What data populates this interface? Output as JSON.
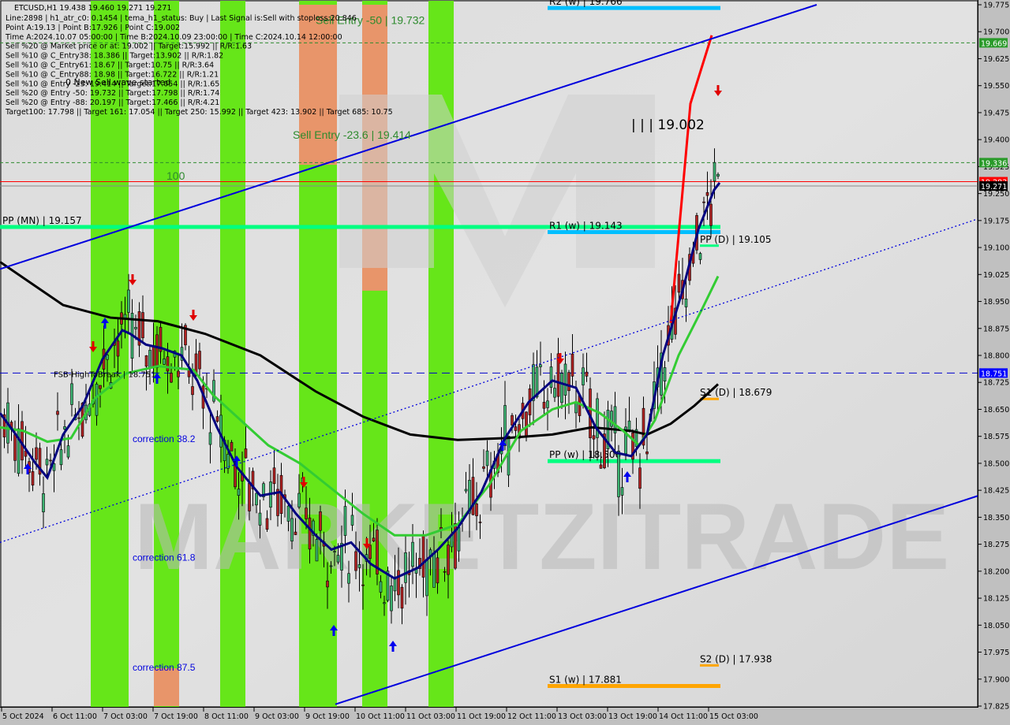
{
  "header": {
    "symbol_line": "ETCUSD,H1  19.438 19.460 19.271 19.271",
    "info_lines": [
      "Line:2898 | h1_atr_c0: 0.1454 | tema_h1_status: Buy | Last Signal is:Sell with stoploss:20.846",
      "Point A:19.13 | Point B:17.926 | Point C:19.002",
      "Time A:2024.10.07 05:00:00 | Time B:2024.10.09 23:00:00 | Time C:2024.10.14 12:00:00",
      "Sell %20 @ Market price or at: 19.002 || Target:15.992 || R/R:1.63",
      "Sell %10 @ C_Entry38: 18.386 || Target:13.902 || R/R:1.82",
      "Sell %10 @ C_Entry61: 18.67 || Target:10.75 || R/R:3.64",
      "Sell %10 @ C_Entry88: 18.98 || Target:16.722 || R/R:1.21",
      "Sell %10 @ Entry -23: 19.414 || Target:17.054 || R/R:1.65",
      "Sell %20 @ Entry -50: 19.732 || Target:17.798 || R/R:1.74",
      "Sell %20 @ Entry -88: 20.197 || Target:17.466 || R/R:4.21",
      "Target100: 17.798 || Target 161: 17.054 || Target 250: 15.992 || Target 423: 13.902 || Target 685: 10.75"
    ],
    "overlay_note": "0 New Sell wave started"
  },
  "watermark": "MARKETZITRADE",
  "chart_data": {
    "type": "candlestick",
    "title": "ETCUSD,H1",
    "xlabel": "",
    "ylabel": "",
    "ylim": [
      17.825,
      19.775
    ],
    "grid": false,
    "x_tick_labels": [
      "5 Oct 2024",
      "6 Oct 11:00",
      "7 Oct 03:00",
      "7 Oct 19:00",
      "8 Oct 11:00",
      "9 Oct 03:00",
      "9 Oct 19:00",
      "10 Oct 11:00",
      "11 Oct 03:00",
      "11 Oct 19:00",
      "12 Oct 11:00",
      "13 Oct 03:00",
      "13 Oct 19:00",
      "14 Oct 11:00",
      "15 Oct 03:00"
    ],
    "y_tick_labels": [
      "19.775",
      "19.700",
      "19.625",
      "19.550",
      "19.475",
      "19.400",
      "19.325",
      "19.250",
      "19.175",
      "19.100",
      "19.025",
      "18.950",
      "18.875",
      "18.800",
      "18.725",
      "18.650",
      "18.575",
      "18.500",
      "18.425",
      "18.350",
      "18.275",
      "18.200",
      "18.125",
      "18.050",
      "17.975",
      "17.900",
      "17.825"
    ],
    "y_ticks": [
      19.775,
      19.7,
      19.625,
      19.55,
      19.475,
      19.4,
      19.325,
      19.25,
      19.175,
      19.1,
      19.025,
      18.95,
      18.875,
      18.8,
      18.725,
      18.65,
      18.575,
      18.5,
      18.425,
      18.35,
      18.275,
      18.2,
      18.125,
      18.05,
      17.975,
      17.9,
      17.825
    ],
    "price_badges": [
      {
        "label": "19.669",
        "value": 19.669,
        "color": "#2a9a2a",
        "text": "#ffffff"
      },
      {
        "label": "19.336",
        "value": 19.336,
        "color": "#2a9a2a",
        "text": "#ffffff"
      },
      {
        "label": "19.283",
        "value": 19.283,
        "color": "#ff0000",
        "text": "#ffffff"
      },
      {
        "label": "19.271",
        "value": 19.271,
        "color": "#000000",
        "text": "#ffffff"
      },
      {
        "label": "18.751",
        "value": 18.751,
        "color": "#0000ff",
        "text": "#ffffff"
      }
    ],
    "levels": [
      {
        "name": "PP (MN)",
        "label": "PP (MN) | 19.157",
        "value": 19.157,
        "color": "#00ff80",
        "span": "full"
      },
      {
        "name": "R1 (w)",
        "label": "R1 (w) | 19.143",
        "value": 19.143,
        "color": "#00bfff",
        "span": "weekly"
      },
      {
        "name": "R2 (w)",
        "label": "R2 (w) | 19.766",
        "value": 19.766,
        "color": "#00bfff",
        "span": "weekly"
      },
      {
        "name": "PP (w)",
        "label": "PP (w) | 18.506",
        "value": 18.506,
        "color": "#00ff80",
        "span": "weekly"
      },
      {
        "name": "S1 (w)",
        "label": "S1 (w) | 17.881",
        "value": 17.881,
        "color": "#ffa500",
        "span": "weekly"
      },
      {
        "name": "PP (D)",
        "label": "PP (D) | 19.105",
        "value": 19.105,
        "color": "#00ff80",
        "span": "daily"
      },
      {
        "name": "S1 (D)",
        "label": "S1 (D) | 18.679",
        "value": 18.679,
        "color": "#ffa500",
        "span": "daily"
      },
      {
        "name": "S2 (D)",
        "label": "S2 (D) | 17.938",
        "value": 17.938,
        "color": "#ffa500",
        "span": "daily"
      }
    ],
    "annotations": [
      {
        "text": "Sell Entry -50 | 19.732",
        "value": 19.732,
        "kind": "sell-entry"
      },
      {
        "text": "Sell Entry -23.6 | 19.414",
        "value": 19.414,
        "kind": "sell-entry"
      },
      {
        "text": "100",
        "value": 19.3,
        "kind": "fib"
      },
      {
        "text": "FSB-HighToBreak | 18.751",
        "value": 18.751,
        "kind": "breakout"
      },
      {
        "text": "| | | 19.002",
        "value": 19.44,
        "kind": "point-c"
      },
      {
        "text": "correction 38.2",
        "value": 18.57,
        "kind": "correction"
      },
      {
        "text": "correction 61.8",
        "value": 18.24,
        "kind": "correction"
      },
      {
        "text": "correction 87.5",
        "value": 17.935,
        "kind": "correction"
      }
    ],
    "dashed_levels": [
      19.669,
      19.336
    ],
    "close_line": 19.271,
    "bid_line": 19.283,
    "series": [
      {
        "name": "MA slow (black)",
        "color": "#000000",
        "points": [
          [
            0,
            19.06
          ],
          [
            40,
            19.0
          ],
          [
            80,
            18.94
          ],
          [
            140,
            18.905
          ],
          [
            200,
            18.895
          ],
          [
            260,
            18.86
          ],
          [
            330,
            18.8
          ],
          [
            400,
            18.7
          ],
          [
            460,
            18.63
          ],
          [
            520,
            18.58
          ],
          [
            580,
            18.565
          ],
          [
            640,
            18.57
          ],
          [
            700,
            18.58
          ],
          [
            750,
            18.6
          ],
          [
            800,
            18.59
          ],
          [
            820,
            18.58
          ],
          [
            850,
            18.61
          ],
          [
            880,
            18.66
          ],
          [
            910,
            18.72
          ]
        ]
      },
      {
        "name": "MA medium (green)",
        "color": "#33cc33",
        "points": [
          [
            0,
            18.6
          ],
          [
            30,
            18.59
          ],
          [
            60,
            18.56
          ],
          [
            90,
            18.57
          ],
          [
            120,
            18.68
          ],
          [
            160,
            18.75
          ],
          [
            200,
            18.77
          ],
          [
            245,
            18.76
          ],
          [
            270,
            18.69
          ],
          [
            310,
            18.61
          ],
          [
            340,
            18.55
          ],
          [
            380,
            18.5
          ],
          [
            420,
            18.43
          ],
          [
            460,
            18.36
          ],
          [
            500,
            18.3
          ],
          [
            540,
            18.3
          ],
          [
            580,
            18.33
          ],
          [
            620,
            18.44
          ],
          [
            660,
            18.59
          ],
          [
            700,
            18.65
          ],
          [
            730,
            18.67
          ],
          [
            760,
            18.64
          ],
          [
            790,
            18.59
          ],
          [
            810,
            18.55
          ],
          [
            830,
            18.62
          ],
          [
            860,
            18.8
          ],
          [
            890,
            18.93
          ],
          [
            910,
            19.02
          ]
        ]
      },
      {
        "name": "MA fast (navy)",
        "color": "#000080",
        "points": [
          [
            0,
            18.64
          ],
          [
            20,
            18.58
          ],
          [
            45,
            18.5
          ],
          [
            60,
            18.46
          ],
          [
            80,
            18.58
          ],
          [
            105,
            18.66
          ],
          [
            130,
            18.79
          ],
          [
            155,
            18.87
          ],
          [
            165,
            18.86
          ],
          [
            185,
            18.83
          ],
          [
            205,
            18.82
          ],
          [
            230,
            18.8
          ],
          [
            250,
            18.73
          ],
          [
            275,
            18.6
          ],
          [
            300,
            18.49
          ],
          [
            330,
            18.41
          ],
          [
            355,
            18.42
          ],
          [
            375,
            18.36
          ],
          [
            400,
            18.3
          ],
          [
            420,
            18.26
          ],
          [
            445,
            18.28
          ],
          [
            470,
            18.22
          ],
          [
            500,
            18.18
          ],
          [
            530,
            18.21
          ],
          [
            555,
            18.26
          ],
          [
            580,
            18.32
          ],
          [
            610,
            18.42
          ],
          [
            640,
            18.57
          ],
          [
            670,
            18.67
          ],
          [
            700,
            18.73
          ],
          [
            730,
            18.71
          ],
          [
            755,
            18.6
          ],
          [
            780,
            18.53
          ],
          [
            800,
            18.52
          ],
          [
            820,
            18.58
          ],
          [
            840,
            18.8
          ],
          [
            865,
            18.98
          ],
          [
            885,
            19.15
          ],
          [
            905,
            19.26
          ],
          [
            912,
            19.28
          ]
        ]
      },
      {
        "name": "Pattern leg (red)",
        "color": "#ff0000",
        "points": [
          [
            850,
            18.89
          ],
          [
            875,
            19.5
          ],
          [
            902,
            19.69
          ]
        ]
      },
      {
        "name": "Channel upper",
        "color": "#0000dd",
        "points": [
          [
            0,
            19.04
          ],
          [
            1035,
            19.775
          ]
        ]
      },
      {
        "name": "Channel lower",
        "color": "#0000dd",
        "points": [
          [
            425,
            17.83
          ],
          [
            1240,
            18.41
          ]
        ]
      },
      {
        "name": "Channel mid dotted",
        "color": "#0000dd",
        "points": [
          [
            0,
            18.28
          ],
          [
            1240,
            19.18
          ]
        ]
      }
    ],
    "vertical_bands": [
      {
        "from": 115,
        "to": 163,
        "color": "#66e619"
      },
      {
        "from": 195,
        "to": 227,
        "color": "#66e619"
      },
      {
        "from": 279,
        "to": 311,
        "color": "#66e619"
      },
      {
        "from": 379,
        "to": 427,
        "color": "#66e619"
      },
      {
        "from": 459,
        "to": 491,
        "color": "#66e619"
      },
      {
        "from": 543,
        "to": 575,
        "color": "#66e619"
      },
      {
        "from": 379,
        "to": 427,
        "color": "#e8956a",
        "top": 19.775,
        "bottom": 19.33
      },
      {
        "from": 459,
        "to": 491,
        "color": "#e8956a",
        "top": 19.775,
        "bottom": 18.98
      },
      {
        "from": 195,
        "to": 227,
        "color": "#e8956a",
        "top": 17.93,
        "bottom": 17.825
      }
    ]
  }
}
